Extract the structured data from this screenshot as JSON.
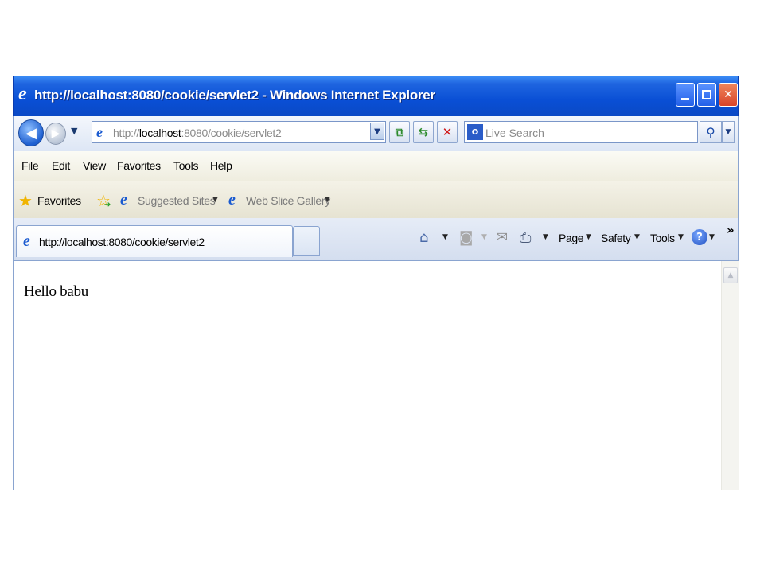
{
  "window": {
    "title": "http://localhost:8080/cookie/servlet2 - Windows Internet Explorer"
  },
  "address_bar": {
    "scheme": "http://",
    "host": "localhost",
    "rest": ":8080/cookie/servlet2"
  },
  "search": {
    "placeholder": "Live Search"
  },
  "menu": {
    "items": [
      "File",
      "Edit",
      "View",
      "Favorites",
      "Tools",
      "Help"
    ]
  },
  "favorites_bar": {
    "label": "Favorites",
    "links": [
      {
        "label": "Suggested Sites"
      },
      {
        "label": "Web Slice Gallery"
      }
    ]
  },
  "tabs": {
    "active_title": "http://localhost:8080/cookie/servlet2"
  },
  "command_bar": {
    "page": "Page",
    "safety": "Safety",
    "tools": "Tools"
  },
  "content": {
    "text": "Hello babu"
  },
  "colors": {
    "titlebar": "#0a4fd5",
    "close_button": "#d8442a"
  }
}
